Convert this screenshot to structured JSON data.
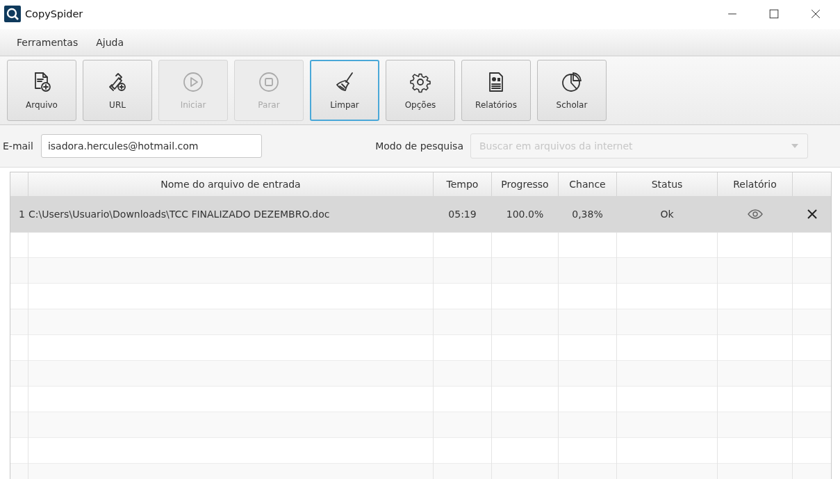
{
  "window": {
    "title": "CopySpider"
  },
  "menu": [
    "Ferramentas",
    "Ajuda"
  ],
  "toolbar": [
    {
      "kind": "file",
      "label": "Arquivo",
      "disabled": false,
      "focused": false
    },
    {
      "kind": "link",
      "label": "URL",
      "disabled": false,
      "focused": false
    },
    {
      "kind": "play",
      "label": "Iniciar",
      "disabled": true,
      "focused": false
    },
    {
      "kind": "stop",
      "label": "Parar",
      "disabled": true,
      "focused": false
    },
    {
      "kind": "broom",
      "label": "Limpar",
      "disabled": false,
      "focused": true
    },
    {
      "kind": "gear",
      "label": "Opções",
      "disabled": false,
      "focused": false
    },
    {
      "kind": "report",
      "label": "Relatórios",
      "disabled": false,
      "focused": false
    },
    {
      "kind": "pie",
      "label": "Scholar",
      "disabled": false,
      "focused": false
    }
  ],
  "email": {
    "label": "E-mail",
    "value": "isadora.hercules@hotmail.com"
  },
  "search_mode": {
    "label": "Modo de pesquisa",
    "value": "Buscar em arquivos da internet",
    "disabled": true
  },
  "table": {
    "columns": [
      "Nome do arquivo de entrada",
      "Tempo",
      "Progresso",
      "Chance",
      "Status",
      "Relatório"
    ],
    "rows": [
      {
        "index": "1",
        "file": "C:\\Users\\Usuario\\Downloads\\TCC FINALIZADO DEZEMBRO.doc",
        "time": "05:19",
        "progress": "100.0%",
        "chance": "0,38%",
        "status": "Ok",
        "selected": true
      }
    ]
  }
}
